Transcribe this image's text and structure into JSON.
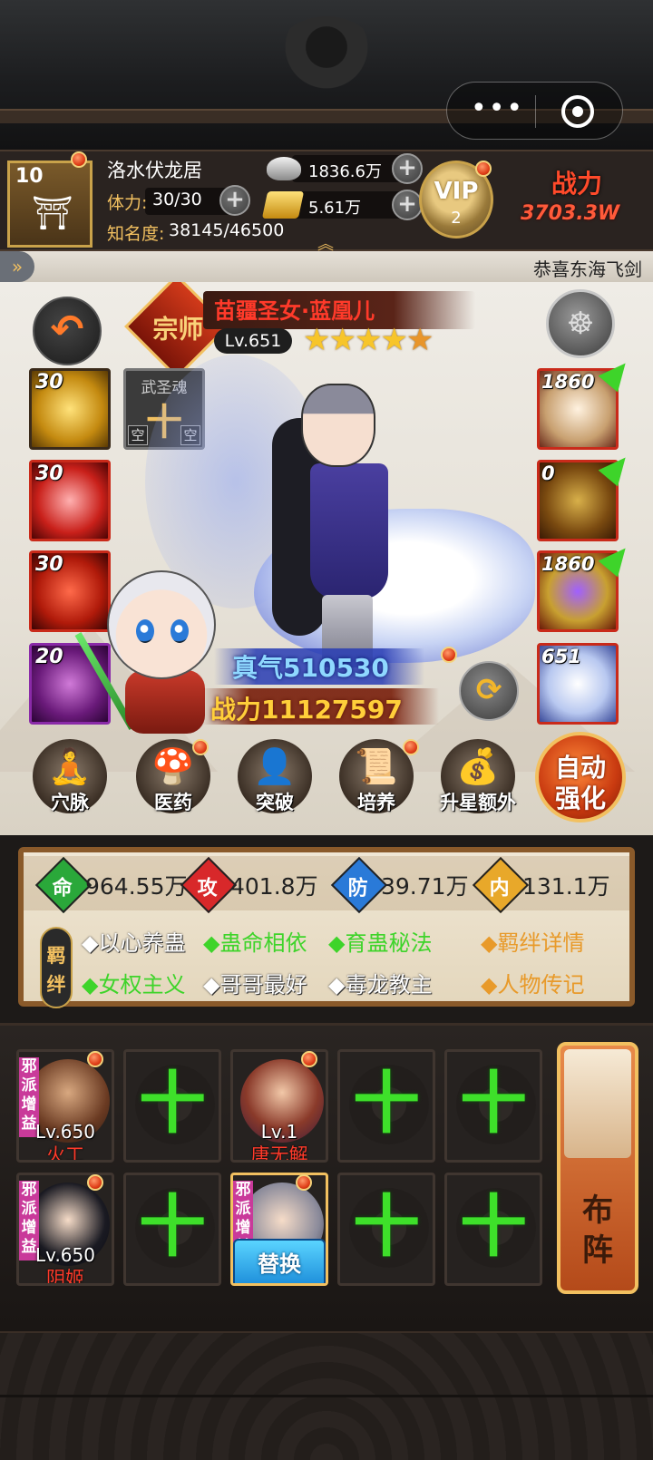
{
  "capsule": {
    "more": "•••",
    "close": "◎"
  },
  "player": {
    "level": "10",
    "name": "洛水伏龙居",
    "stamina_label": "体力:",
    "stamina_value": "30/30",
    "fame_label": "知名度:",
    "fame_value": "38145/46500"
  },
  "currency": {
    "silver": "1836.6万",
    "gold": "5.61万"
  },
  "vip": {
    "label": "VIP",
    "level": "2"
  },
  "total_power": {
    "label": "战力",
    "value": "3703.3W"
  },
  "ticker": {
    "message": "恭喜东海飞剑"
  },
  "hero": {
    "badge": "宗师",
    "name": "苗疆圣女·蓝凰儿",
    "level": "Lv.651",
    "stars": 5,
    "true_qi": "真气510530",
    "power": "战力11127597"
  },
  "skills": [
    "30",
    "30",
    "30",
    "20"
  ],
  "soul_slot": {
    "title": "武圣魂",
    "empty_left": "空",
    "empty_right": "空"
  },
  "equipment": [
    "1860",
    "0",
    "1860",
    "651"
  ],
  "functions": [
    "穴脉",
    "医药",
    "突破",
    "培养",
    "升星额外"
  ],
  "auto_strengthen": [
    "自动",
    "强化"
  ],
  "stats": [
    {
      "icon": "命",
      "value": "964.55万",
      "color": "#2aa83a"
    },
    {
      "icon": "攻",
      "value": "401.8万",
      "color": "#d8282a"
    },
    {
      "icon": "防",
      "value": "39.71万",
      "color": "#2a7ad8"
    },
    {
      "icon": "内",
      "value": "131.1万",
      "color": "#e8a82a"
    }
  ],
  "bond_tag": [
    "羁",
    "绊"
  ],
  "bonds": [
    {
      "text": "◆以心养蛊",
      "active": false
    },
    {
      "text": "◆蛊命相依",
      "active": true
    },
    {
      "text": "◆育蛊秘法",
      "active": true
    },
    {
      "text": "◆女权主义",
      "active": true
    },
    {
      "text": "◆哥哥最好",
      "active": false
    },
    {
      "text": "◆毒龙教主",
      "active": false
    }
  ],
  "links": {
    "bond_details": "◆羁绊详情",
    "biography": "◆人物传记"
  },
  "lineup": {
    "row1": [
      {
        "level": "Lv.650",
        "name": "火工",
        "sect": "邪派增益"
      },
      {
        "empty": "十"
      },
      {
        "level": "Lv.1",
        "name": "唐无解"
      },
      {
        "empty": "十"
      },
      {
        "empty": "十"
      }
    ],
    "row2": [
      {
        "level": "Lv.650",
        "name": "阴姬",
        "sect": "邪派增益"
      },
      {
        "empty": "十"
      },
      {
        "replace": "替换",
        "sect": "邪派增益"
      },
      {
        "empty": "十"
      },
      {
        "empty": "十"
      }
    ],
    "formation": [
      "布",
      "阵"
    ]
  }
}
